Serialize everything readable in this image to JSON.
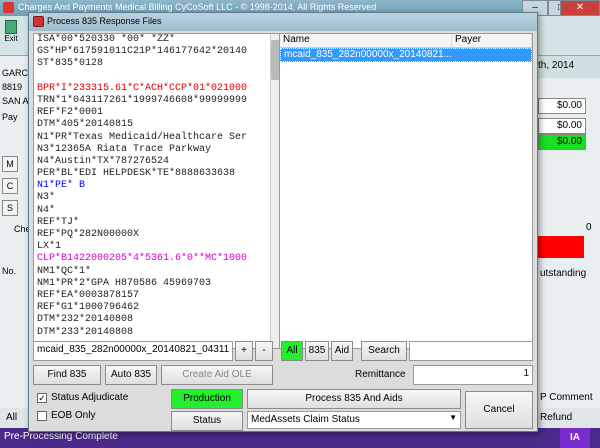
{
  "app": {
    "title": "Charges And Payments   Medical Billing CyCoSoft LLC - © 1998-2014, All Rights Reserved",
    "exit_label": "Exit",
    "date_text": "th, 2014",
    "left_labels": [
      "GARC",
      "8819",
      "SAN A",
      "Pay"
    ],
    "side_buttons": [
      "M",
      "C",
      "S"
    ],
    "no_label": "No.",
    "che_label": "Che",
    "money": [
      "$0.00",
      "$0.00",
      "$0.00"
    ],
    "zero_value": "0",
    "outstanding_label": "utstanding",
    "bottom_labels": [
      "All",
      "P Comment",
      "Refund"
    ],
    "status_text": "Pre-Processing Complete",
    "ia_badge": "IA"
  },
  "dialog": {
    "title": "Process 835 Response Files",
    "edi_lines": [
      {
        "text": "ISA*00*520330     *00*          *ZZ*",
        "color": "#222"
      },
      {
        "text": "GS*HP*617591011C21P*146177642*20140",
        "color": "#222"
      },
      {
        "text": "ST*835*0128",
        "color": "#222"
      },
      {
        "text": "",
        "color": "#222"
      },
      {
        "text": "BPR*I*233315.61*C*ACH*CCP*01*021000",
        "color": "#e00000"
      },
      {
        "text": "TRN*1*043117261*1999746608*99999999",
        "color": "#222"
      },
      {
        "text": "REF*F2*0001",
        "color": "#222"
      },
      {
        "text": "DTM*405*20140815",
        "color": "#222"
      },
      {
        "text": "N1*PR*Texas Medicaid/Healthcare Ser",
        "color": "#222"
      },
      {
        "text": "N3*12365A Riata Trace Parkway",
        "color": "#222"
      },
      {
        "text": "N4*Austin*TX*787276524",
        "color": "#222"
      },
      {
        "text": "PER*BL*EDI HELPDESK*TE*8888633638",
        "color": "#222"
      },
      {
        "text": "N1*PE*                            B",
        "color": "#0000ff"
      },
      {
        "text": "N3*",
        "color": "#222"
      },
      {
        "text": "N4*",
        "color": "#222"
      },
      {
        "text": "REF*TJ*",
        "color": "#222"
      },
      {
        "text": "REF*PQ*282N00000X",
        "color": "#222"
      },
      {
        "text": "LX*1",
        "color": "#222"
      },
      {
        "text": "CLP*B1422000205*4*5361.6*0**MC*1000",
        "color": "#d000d0"
      },
      {
        "text": "NM1*QC*1*",
        "color": "#222"
      },
      {
        "text": "NM1*PR*2*GPA       H870586 45969703",
        "color": "#222"
      },
      {
        "text": "REF*EA*0003878157",
        "color": "#222"
      },
      {
        "text": "REF*G1*1000796462",
        "color": "#222"
      },
      {
        "text": "DTM*232*20140808",
        "color": "#222"
      },
      {
        "text": "DTM*233*20140808",
        "color": "#222"
      }
    ],
    "grid": {
      "columns": [
        "Name",
        "Payer"
      ],
      "rows": [
        {
          "name": "mcaid_835_282n00000x_20140821...",
          "payer": ""
        }
      ]
    },
    "file_field": "mcaid_835_282n00000x_20140821_04311",
    "plus_label": "+",
    "minus_label": "-",
    "filter_all": "All",
    "filter_835": "835",
    "filter_aid": "Aid",
    "search_label": "Search",
    "search_value": "",
    "find_label": "Find 835",
    "auto_label": "Auto 835",
    "create_label": "Create Aid OLE",
    "remittance_label": "Remittance",
    "remittance_value": "1",
    "status_adjudicate_label": "Status Adjudicate",
    "status_adjudicate_checked": "✓",
    "eob_only_label": "EOB Only",
    "production_label": "Production",
    "status_button_label": "Status",
    "process_label": "Process 835 And Aids",
    "claim_status_select": "MedAssets Claim Status",
    "cancel_label": "Cancel"
  }
}
